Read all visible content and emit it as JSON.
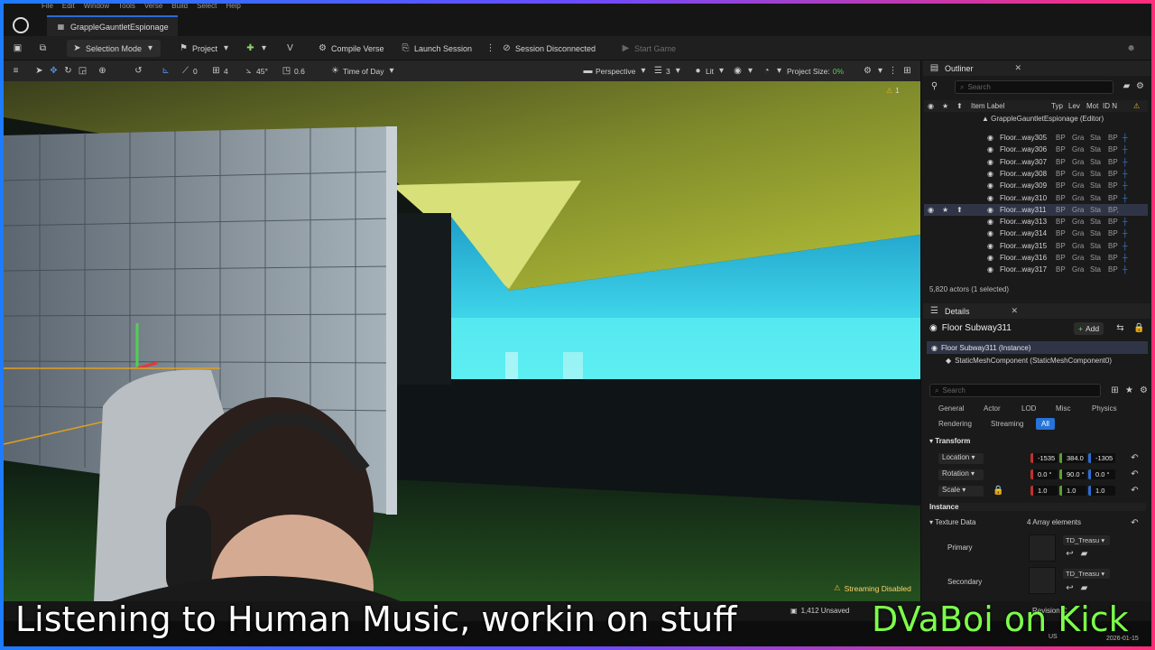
{
  "menu": [
    "File",
    "Edit",
    "Window",
    "Tools",
    "Verse",
    "Build",
    "Select",
    "Help"
  ],
  "project_tab": "GrappleGauntletEspionage",
  "toolbar": {
    "mode": "Selection Mode",
    "project": "Project",
    "compile": "Compile Verse",
    "launch": "Launch Session",
    "session": "Session Disconnected",
    "start": "Start Game"
  },
  "viewport_toolbar": {
    "rotate_snap": "0",
    "grid": "4",
    "angle": "45°",
    "scale": "0.6",
    "time_of_day": "Time of Day",
    "perspective": "Perspective",
    "camera_speed": "3",
    "lit": "Lit",
    "project_size_label": "Project Size:",
    "project_size_value": "0%",
    "warning_count": "1"
  },
  "viewport": {
    "streaming": "Streaming Disabled",
    "accent_colors": {
      "floor": "#1f3a1e",
      "wall": "#8fa0a8",
      "sky": "#2fd3e0",
      "ceiling": "#b9c23a"
    }
  },
  "outliner": {
    "title": "Outliner",
    "search_placeholder": "Search",
    "columns": {
      "label": "Item Label",
      "type": "Typ",
      "level": "Lev",
      "mod": "Mot",
      "id": "ID N"
    },
    "root": "GrappleGauntletEspionage (Editor)",
    "rows": [
      {
        "label": "Floor...way305",
        "type": "BP",
        "c2": "Gra",
        "c3": "Sta",
        "c4": "BP"
      },
      {
        "label": "Floor...way306",
        "type": "BP",
        "c2": "Gra",
        "c3": "Sta",
        "c4": "BP"
      },
      {
        "label": "Floor...way307",
        "type": "BP",
        "c2": "Gra",
        "c3": "Sta",
        "c4": "BP"
      },
      {
        "label": "Floor...way308",
        "type": "BP",
        "c2": "Gra",
        "c3": "Sta",
        "c4": "BP"
      },
      {
        "label": "Floor...way309",
        "type": "BP",
        "c2": "Gra",
        "c3": "Sta",
        "c4": "BP"
      },
      {
        "label": "Floor...way310",
        "type": "BP",
        "c2": "Gra",
        "c3": "Sta",
        "c4": "BP"
      },
      {
        "label": "Floor...way311",
        "type": "BP",
        "c2": "Gra",
        "c3": "Sta",
        "c4": "BP,"
      },
      {
        "label": "Floor...way313",
        "type": "BP",
        "c2": "Gra",
        "c3": "Sta",
        "c4": "BP"
      },
      {
        "label": "Floor...way314",
        "type": "BP",
        "c2": "Gra",
        "c3": "Sta",
        "c4": "BP"
      },
      {
        "label": "Floor...way315",
        "type": "BP",
        "c2": "Gra",
        "c3": "Sta",
        "c4": "BP"
      },
      {
        "label": "Floor...way316",
        "type": "BP",
        "c2": "Gra",
        "c3": "Sta",
        "c4": "BP"
      },
      {
        "label": "Floor...way317",
        "type": "BP",
        "c2": "Gra",
        "c3": "Sta",
        "c4": "BP"
      }
    ],
    "selected_index": 6,
    "actor_count": "5,820 actors (1 selected)"
  },
  "details": {
    "title": "Details",
    "object_name": "Floor Subway311",
    "add_label": "Add",
    "instance": "Floor Subway311 (Instance)",
    "component": "StaticMeshComponent (StaticMeshComponent0)",
    "search_placeholder": "Search",
    "categories": [
      "General",
      "Actor",
      "LOD",
      "Misc",
      "Physics",
      "Rendering",
      "Streaming",
      "All"
    ],
    "active_category": "All",
    "transform_header": "Transform",
    "location_label": "Location",
    "location": [
      "-1535",
      "384.0",
      "-1305"
    ],
    "rotation_label": "Rotation",
    "rotation": [
      "0.0 °",
      "90.0 °",
      "0.0 °"
    ],
    "scale_label": "Scale",
    "scale": [
      "1.0",
      "1.0",
      "1.0"
    ],
    "instance_header": "Instance",
    "texture_label": "Texture Data",
    "texture_count": "4 Array elements",
    "primary_label": "Primary",
    "primary_value": "TD_Treasu",
    "secondary_label": "Secondary",
    "secondary_value": "TD_Treasu"
  },
  "statusbar": {
    "unsaved": "1,412 Unsaved",
    "revision": "Revision C"
  },
  "overlay": {
    "caption": "Listening to Human Music, workin on stuff",
    "brand": "DVaBoi on Kick",
    "clock_date": "2026-01-15",
    "locale": "US"
  }
}
